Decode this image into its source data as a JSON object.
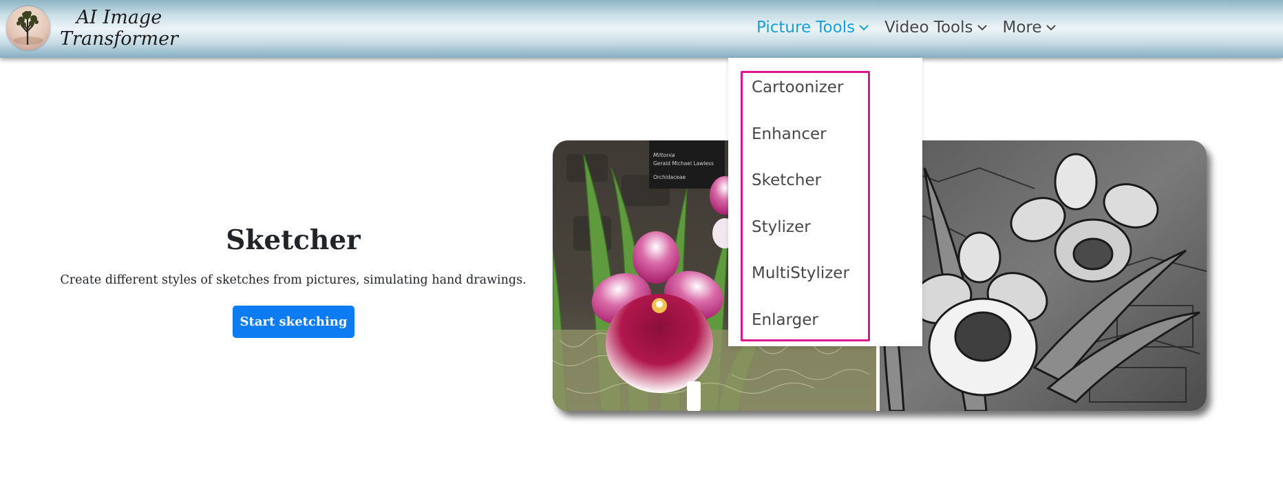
{
  "header": {
    "logo_line1": "AI Image",
    "logo_line2": "Transformer",
    "nav": [
      {
        "label": "Picture Tools",
        "active": true
      },
      {
        "label": "Video Tools",
        "active": false
      },
      {
        "label": "More",
        "active": false
      }
    ]
  },
  "dropdown": {
    "items": [
      "Cartoonizer",
      "Enhancer",
      "Sketcher",
      "Stylizer",
      "MultiStylizer",
      "Enlarger"
    ],
    "highlight_color": "#e0148f"
  },
  "hero": {
    "title": "Sketcher",
    "description": "Create different styles of sketches from pictures, simulating hand drawings.",
    "button_label": "Start sketching"
  },
  "sign": {
    "line1": "Miltonia",
    "line2": "Gerald Michael Lawless",
    "line3": "Orchidaceae"
  },
  "colors": {
    "accent": "#12a1e0",
    "button": "#0d7bf2",
    "nav_text": "#474747"
  },
  "icons": {
    "chevron": "chevron-down-icon",
    "logo": "tree-logo-icon"
  }
}
